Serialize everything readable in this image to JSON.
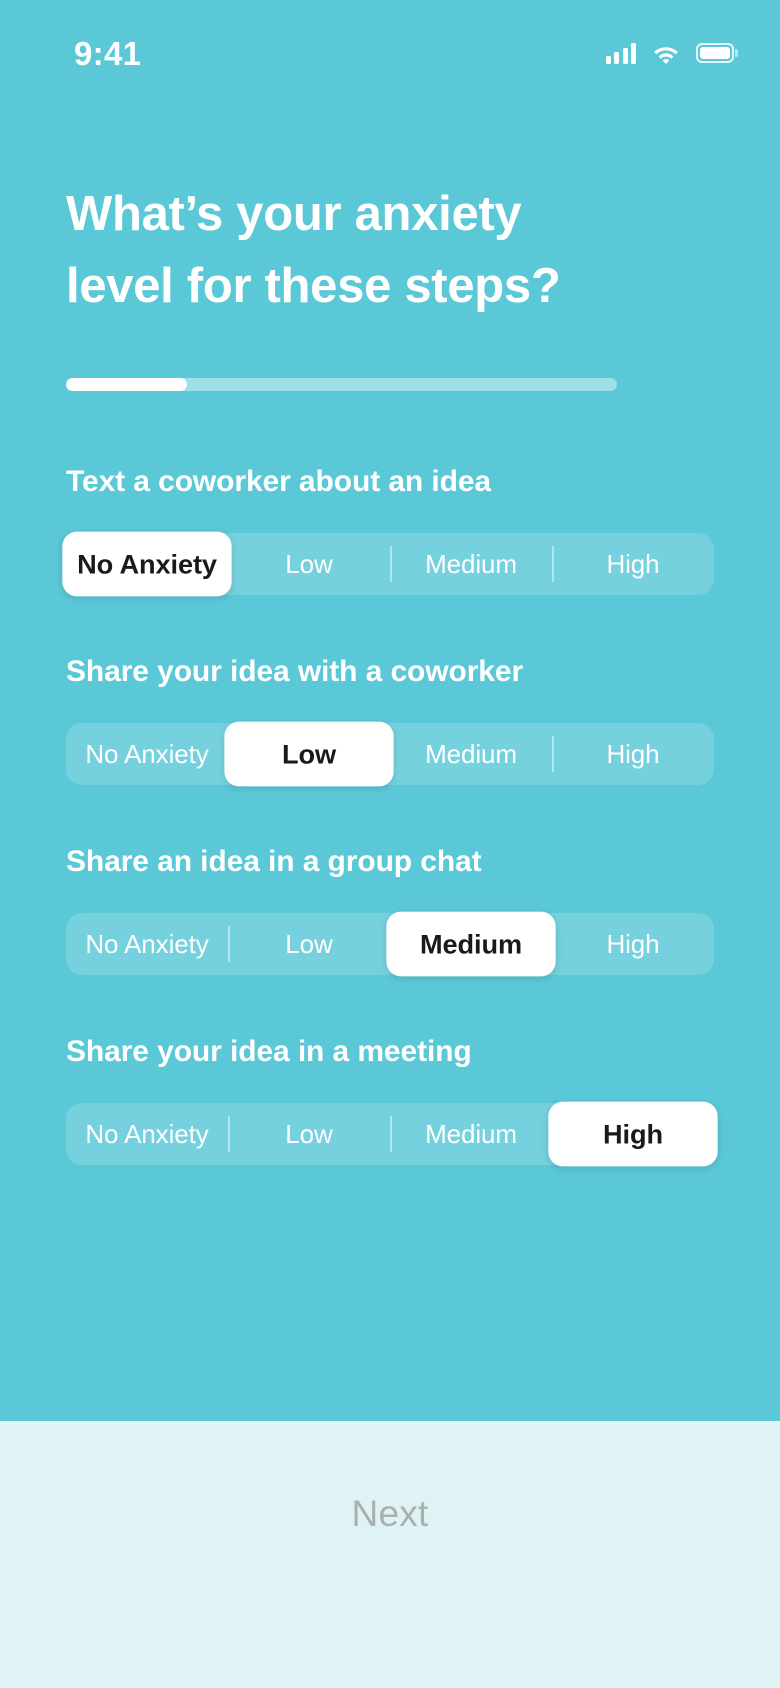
{
  "theme": {
    "background": "#5bc8d8",
    "footer_background": "#e0f3f4",
    "accent_white": "#ffffff",
    "next_label_color": "#a8b0b2",
    "selected_text_color": "#1a1a1a"
  },
  "status_bar": {
    "time": "9:41",
    "icons": [
      "cellular-signal-icon",
      "wifi-icon",
      "battery-icon"
    ]
  },
  "header": {
    "title": "What’s your anxiety level for these steps?"
  },
  "progress": {
    "percent": 22,
    "percent_label": "22%"
  },
  "options": [
    "No Anxiety",
    "Low",
    "Medium",
    "High"
  ],
  "questions": [
    {
      "label": "Text a coworker about an idea",
      "options": [
        "No Anxiety",
        "Low",
        "Medium",
        "High"
      ],
      "selected_index": 0,
      "selected_value": "No Anxiety"
    },
    {
      "label": "Share your idea with a coworker",
      "options": [
        "No Anxiety",
        "Low",
        "Medium",
        "High"
      ],
      "selected_index": 1,
      "selected_value": "Low"
    },
    {
      "label": "Share an idea in a group chat",
      "options": [
        "No Anxiety",
        "Low",
        "Medium",
        "High"
      ],
      "selected_index": 2,
      "selected_value": "Medium"
    },
    {
      "label": "Share your idea in a meeting",
      "options": [
        "No Anxiety",
        "Low",
        "Medium",
        "High"
      ],
      "selected_index": 3,
      "selected_value": "High"
    }
  ],
  "footer": {
    "next_label": "Next"
  }
}
